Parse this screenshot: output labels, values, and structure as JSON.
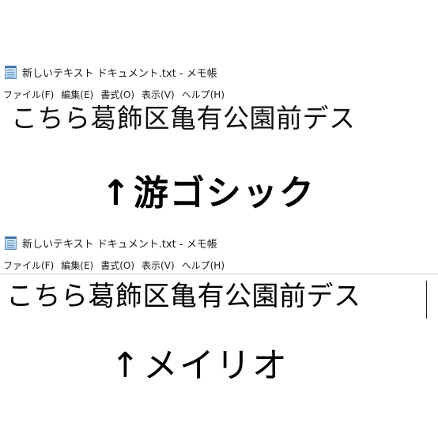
{
  "windows": [
    {
      "title": "新しいテキスト ドキュメント.txt - メモ帳",
      "menu": [
        "ファイル(F)",
        "編集(E)",
        "書式(O)",
        "表示(V)",
        "ヘルプ(H)"
      ],
      "content": "こちら葛飾区亀有公園前デス",
      "caption_arrow": "↑",
      "caption": "游ゴシック"
    },
    {
      "title": "新しいテキスト ドキュメント.txt - メモ帳",
      "menu": [
        "ファイル(F)",
        "編集(E)",
        "書式(O)",
        "表示(V)",
        "ヘルプ(H)"
      ],
      "content": "こちら葛飾区亀有公園前デス",
      "caption_arrow": "↑",
      "caption": "メイリオ"
    }
  ],
  "icons": {
    "app_icon": "notepad-icon"
  }
}
